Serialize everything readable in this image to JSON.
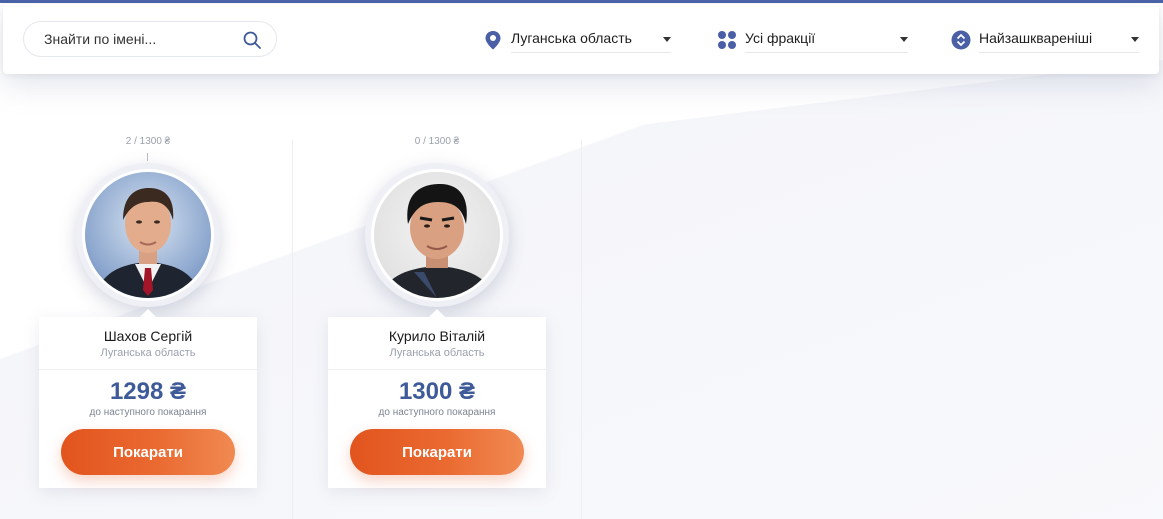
{
  "filters": {
    "search": {
      "placeholder": "Знайти по імені...",
      "value": ""
    },
    "region": {
      "label": "Луганська область",
      "icon": "map-pin-icon"
    },
    "faction": {
      "label": "Усі фракції",
      "icon": "grid-icon"
    },
    "sort": {
      "label": "Найзашквареніші",
      "icon": "sort-icon"
    }
  },
  "colors": {
    "accent": "#3f5a99",
    "icon": "#4a5fa6",
    "button": "#e2541e"
  },
  "cards": [
    {
      "counter": "2 / 1300 ₴",
      "name": "Шахов Сергій",
      "region": "Луганська область",
      "amount": "1298 ₴",
      "amount_caption": "до наступного покарання",
      "button": "Покарати"
    },
    {
      "counter": "0 / 1300 ₴",
      "name": "Курило Віталій",
      "region": "Луганська область",
      "amount": "1300 ₴",
      "amount_caption": "до наступного покарання",
      "button": "Покарати"
    }
  ]
}
